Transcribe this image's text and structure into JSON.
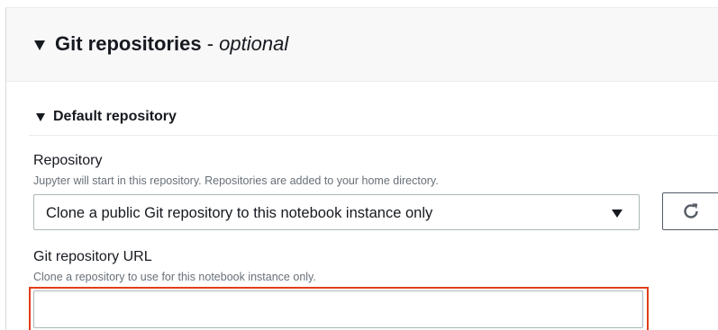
{
  "section": {
    "title": "Git repositories",
    "separator": " - ",
    "optional": "optional"
  },
  "subsection": {
    "title": "Default repository"
  },
  "repository": {
    "label": "Repository",
    "description": "Jupyter will start in this repository. Repositories are added to your home directory.",
    "selected_value": "Clone a public Git repository to this notebook instance only"
  },
  "git_url": {
    "label": "Git repository URL",
    "description": "Clone a repository to use for this notebook instance only.",
    "value": "",
    "placeholder": ""
  },
  "colors": {
    "highlight": "#e03e1a",
    "header_bg": "#f8f8f8",
    "description_text": "#687078"
  },
  "icons": {
    "section_toggle": "caret-down-icon",
    "subsection_toggle": "caret-down-icon",
    "select_dropdown": "caret-down-icon",
    "refresh": "refresh-icon"
  }
}
